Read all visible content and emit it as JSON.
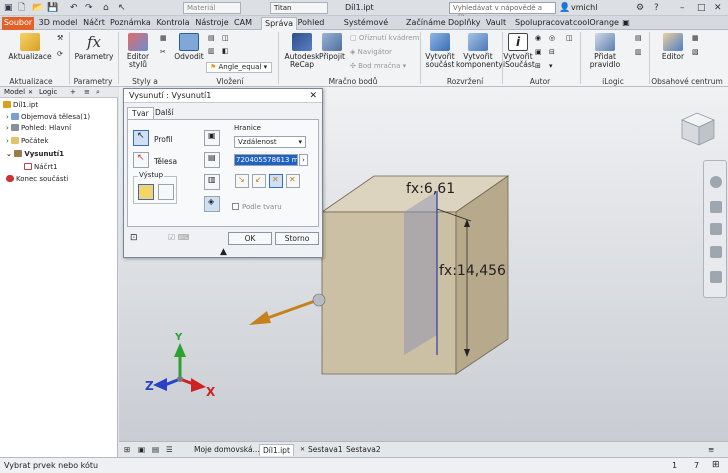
{
  "app": {
    "document_title": "Díl1.ipt",
    "search_placeholder": "Vyhledávat v nápovědě a příkaze",
    "user_name": "vmichl",
    "material_value": "Titan",
    "appearance_value": "Materiál"
  },
  "tabs": [
    "Soubor",
    "3D model",
    "Náčrt",
    "Poznámka",
    "Kontrola",
    "Nástroje",
    "CAM",
    "Správa",
    "Pohled",
    "Systémové prostředí",
    "Začínáme",
    "Doplňky",
    "Vault",
    "Spolupracovat",
    "coolOrange"
  ],
  "ribbon": {
    "update_label": "Aktualizace",
    "parameters_label": "Parametry",
    "style_editor_label": "Editor stylů",
    "derive_label": "Odvodit",
    "recap_label": "Autodesk ReCap",
    "attach_label": "Připojit",
    "clip_label": "Oříznutí kvádrem",
    "navigator_label": "Navigátor",
    "pointcloud_label": "Bod mračna",
    "create_part_label": "Vytvořit součást",
    "create_components_label": "Vytvořit komponenty",
    "create_ipart_label": "Vytvořit iSoučást",
    "add_rule_label": "Přidat pravidlo",
    "editor_label": "Editor",
    "angle_equal_value": "Angle_equal",
    "groups": [
      "Aktualizace",
      "Parametry",
      "Styly a normy",
      "Vložení",
      "Mračno bodů",
      "Rozvržení",
      "Autor",
      "iLogic",
      "Obsahové centrum"
    ]
  },
  "browser": {
    "tabs": [
      "Model",
      "Logic"
    ],
    "items": [
      "Díl1.ipt",
      "Objemová tělesa(1)",
      "Pohled: Hlavní",
      "Počátek",
      "Vysunutí1",
      "Náčrt1",
      "Konec součásti"
    ]
  },
  "dialog": {
    "title": "Vysunutí : Vysunutí1",
    "tabs": [
      "Tvar",
      "Další"
    ],
    "profile_label": "Profil",
    "solids_label": "Tělesa",
    "output_label": "Výstup",
    "extents_label": "Hranice",
    "extents_value": "Vzdálenost",
    "distance_value": "7204055786​13 mm",
    "match_shape_label": "Podle tvaru",
    "ok_label": "OK",
    "cancel_label": "Storno"
  },
  "viewport": {
    "dim1": "fx:6,61",
    "dim2": "fx:14,456",
    "axis_x": "X",
    "axis_y": "Y",
    "axis_z": "Z"
  },
  "docbar": {
    "tabs": [
      "Moje domovská...",
      "Díl1.ipt",
      "Sestava1",
      "Sestava2"
    ]
  },
  "status": {
    "message": "Vybrat prvek nebo kótu",
    "count1": "1",
    "count2": "7"
  },
  "colors": {
    "file_tab": "#e0622a",
    "part_face": "#cbbfa4",
    "arrow": "#c5811e"
  }
}
